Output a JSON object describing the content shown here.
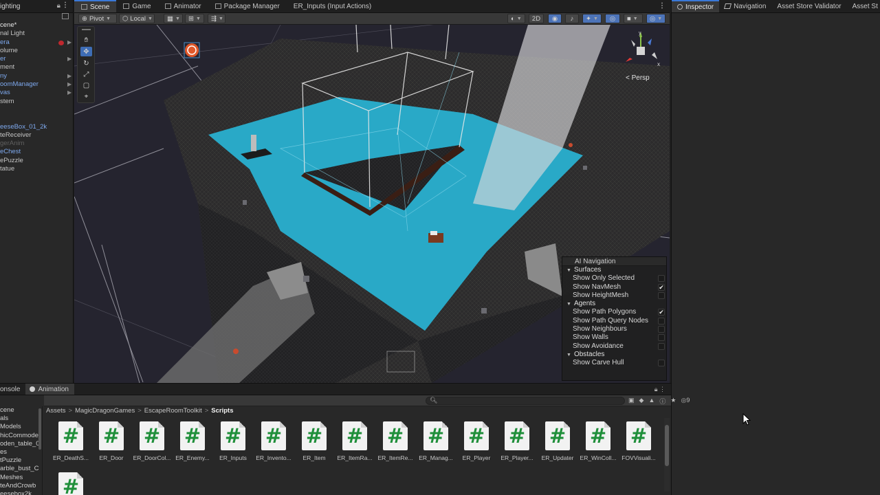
{
  "hierarchy": {
    "tab_label": "ighting",
    "items": [
      {
        "label": "cene*",
        "style": "scene"
      },
      {
        "label": "nal Light",
        "style": "normal"
      },
      {
        "label": "era",
        "style": "blue",
        "arrow": true,
        "error": true
      },
      {
        "label": "olume",
        "style": "normal"
      },
      {
        "label": "er",
        "style": "blue",
        "arrow": true
      },
      {
        "label": "ment",
        "style": "normal"
      },
      {
        "label": "ny",
        "style": "blue",
        "arrow": true
      },
      {
        "label": "oomManager",
        "style": "blue",
        "arrow": true
      },
      {
        "label": "vas",
        "style": "blue",
        "arrow": true
      },
      {
        "label": "stem",
        "style": "normal"
      },
      {
        "label": "",
        "style": "normal"
      },
      {
        "label": "",
        "style": "normal"
      },
      {
        "label": "eeseBox_01_2k",
        "style": "blue"
      },
      {
        "label": "teReceiver",
        "style": "normal"
      },
      {
        "label": "gerAnim",
        "style": "dim"
      },
      {
        "label": "eChest",
        "style": "blue"
      },
      {
        "label": "ePuzzle",
        "style": "normal"
      },
      {
        "label": "tatue",
        "style": "normal"
      }
    ]
  },
  "scene_tabs": [
    {
      "label": "Scene",
      "icon": "scene-icon",
      "active": true
    },
    {
      "label": "Game",
      "icon": "game-icon",
      "active": false
    },
    {
      "label": "Animator",
      "icon": "animator-icon",
      "active": false
    },
    {
      "label": "Package Manager",
      "icon": "package-icon",
      "active": false
    },
    {
      "label": "ER_Inputs (Input Actions)",
      "icon": "",
      "active": false
    }
  ],
  "scene_toolbar": {
    "pivot_label": "Pivot",
    "local_label": "Local",
    "mode_2d_label": "2D"
  },
  "view_label": "< Persp",
  "ai_navigation": {
    "title": "AI Navigation",
    "sections": [
      {
        "label": "Surfaces",
        "rows": [
          {
            "label": "Show Only Selected",
            "checked": false
          },
          {
            "label": "Show NavMesh",
            "checked": true
          },
          {
            "label": "Show HeightMesh",
            "checked": false
          }
        ]
      },
      {
        "label": "Agents",
        "rows": [
          {
            "label": "Show Path Polygons",
            "checked": true
          },
          {
            "label": "Show Path Query Nodes",
            "checked": false
          },
          {
            "label": "Show Neighbours",
            "checked": false
          },
          {
            "label": "Show Walls",
            "checked": false
          },
          {
            "label": "Show Avoidance",
            "checked": false
          }
        ]
      },
      {
        "label": "Obstacles",
        "rows": [
          {
            "label": "Show Carve Hull",
            "checked": false
          }
        ]
      }
    ]
  },
  "inspector_tabs": [
    {
      "label": "Inspector",
      "icon": "info-icon",
      "active": true
    },
    {
      "label": "Navigation",
      "icon": "navigation-icon",
      "active": false
    },
    {
      "label": "Asset Store Validator",
      "icon": "",
      "active": false
    },
    {
      "label": "Asset St",
      "icon": "",
      "active": false
    }
  ],
  "bottom_tabs": [
    {
      "label": "onsole",
      "icon": "",
      "active": false
    },
    {
      "label": "Animation",
      "icon": "animation-icon",
      "active": true
    }
  ],
  "badge_count": "9",
  "project_folders": [
    "cene",
    "als",
    "Models",
    "hicCommode",
    "oden_table_0",
    "es",
    "tPuzzle",
    "arble_bust_C",
    "Meshes",
    "teAndCrowb",
    "eesebox2k"
  ],
  "breadcrumb": [
    "Assets",
    "MagicDragonGames",
    "EscapeRoomToolkit",
    "Scripts"
  ],
  "assets": [
    "ER_DeathS...",
    "ER_Door",
    "ER_DoorCol...",
    "ER_Enemy...",
    "ER_Inputs",
    "ER_Invento...",
    "ER_Item",
    "ER_ItemRa...",
    "ER_ItemRe...",
    "ER_Manag...",
    "ER_Player",
    "ER_Player...",
    "ER_Updater",
    "ER_WinColl...",
    "FOVVisuali...",
    ""
  ],
  "colors": {
    "accent": "#3a79d8",
    "navmesh": "#29a9c7",
    "script_hash": "#1f8f3a",
    "panel_bg": "#282828",
    "error": "#c0282e"
  }
}
